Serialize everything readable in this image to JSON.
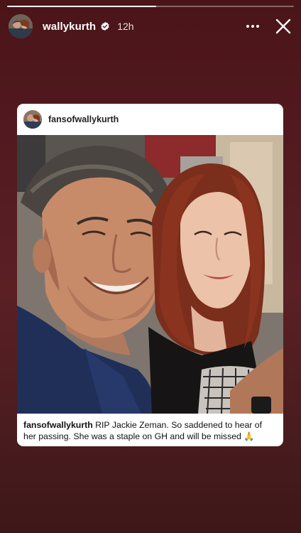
{
  "story": {
    "progress_fraction": 0.52,
    "username": "wallykurth",
    "verified": true,
    "time_ago": "12h"
  },
  "icons": {
    "more": "more-horizontal-icon",
    "close": "close-icon",
    "verified": "verified-badge-icon"
  },
  "post": {
    "username": "fansofwallykurth",
    "caption_user": "fansofwallykurth",
    "caption_text": " RIP Jackie Zeman. So saddened to hear of her passing. She was a staple on GH and will be missed 🙏"
  },
  "colors": {
    "verified_badge": "#3897f0",
    "background_top": "#4a1418",
    "background_bottom": "#3e1719"
  }
}
